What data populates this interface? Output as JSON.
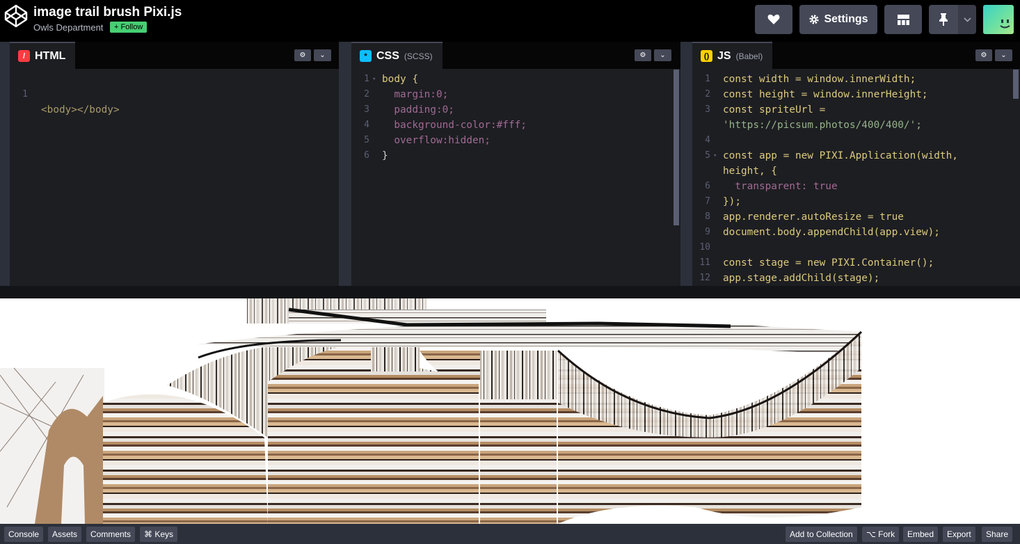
{
  "header": {
    "title": "image trail brush Pixi.js",
    "user": "Owls Department",
    "follow_label": "+ Follow",
    "settings_label": "Settings"
  },
  "panes": {
    "html": {
      "label": "HTML",
      "sub": ""
    },
    "css": {
      "label": "CSS",
      "sub": "(SCSS)"
    },
    "js": {
      "label": "JS",
      "sub": "(Babel)"
    }
  },
  "html_code": [
    "<body></body>"
  ],
  "css_code": [
    "body {",
    "  margin:0;",
    "  padding:0;",
    "  background-color:#fff;",
    "  overflow:hidden;",
    "}"
  ],
  "js_code": [
    "const width = window.innerWidth;",
    "const height = window.innerHeight;",
    "const spriteUrl =",
    "'https://picsum.photos/400/400/';",
    "",
    "const app = new PIXI.Application(width,",
    "height, {",
    "  transparent: true",
    "});",
    "app.renderer.autoResize = true",
    "document.body.appendChild(app.view);",
    "",
    "const stage = new PIXI.Container();",
    "app.stage.addChild(stage);"
  ],
  "line_numbers": {
    "html": [
      "1"
    ],
    "css": [
      "1",
      "2",
      "3",
      "4",
      "5",
      "6"
    ],
    "js": [
      "1",
      "2",
      "3",
      "",
      "4",
      "5",
      "",
      "6",
      "7",
      "8",
      "9",
      "10",
      "11",
      "12"
    ]
  },
  "footer": {
    "console": "Console",
    "assets": "Assets",
    "comments": "Comments",
    "keys": "⌘ Keys",
    "add_to_collection": "Add to Collection",
    "fork": "⌥ Fork",
    "embed": "Embed",
    "export": "Export",
    "share": "Share"
  },
  "colors": {
    "accent_green": "#47cf73",
    "editor_bg": "#1d1e22",
    "button_bg": "#444857"
  },
  "icons": {
    "logo": "codepen-logo-icon",
    "heart": "heart-icon",
    "settings": "gear-icon",
    "layout": "layout-grid-icon",
    "pin": "pin-icon"
  }
}
